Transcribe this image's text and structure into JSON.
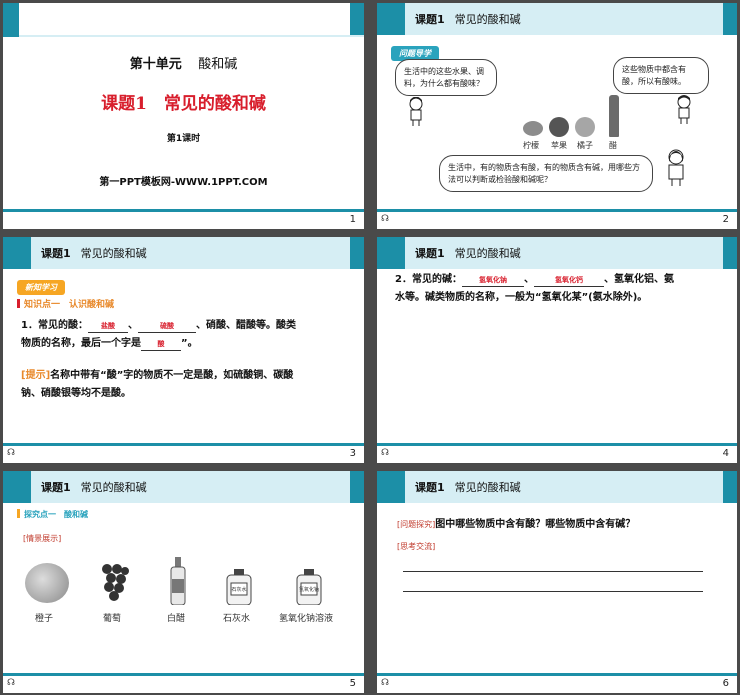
{
  "slide1": {
    "unit": "第十单元",
    "unit_name": "酸和碱",
    "lesson_title": "课题1　常见的酸和碱",
    "period": "第1课时",
    "site": "第一PPT模板网-WWW.1PPT.COM",
    "page": "1"
  },
  "header": {
    "lesson": "课题1",
    "topic": "常见的酸和碱"
  },
  "slide2": {
    "tag": "问题导学",
    "q1": "生活中的这些水果、调料，为什么都有酸味？",
    "q2": "这些物质中都含有酸，所以有酸味。",
    "q3": "生活中，有的物质含有酸，有的物质含有碱，用哪些方法可以判断或检验酸和碱呢？",
    "labels": [
      "柠檬",
      "苹果",
      "橘子",
      "醋"
    ],
    "page": "2"
  },
  "slide3": {
    "tag": "新知学习",
    "point": "知识点一　认识酸和碱",
    "l1a": "1．常见的酸：",
    "ans1": "盐酸",
    "sep1": "、",
    "ans2": "硫酸",
    "l1b": "、硝酸、醋酸等。酸类",
    "l2a": "物质的名称，最后一个字是",
    "ans3": "酸",
    "l2b": "”。",
    "hint_tag": "[提示]",
    "hint1": "名称中带有“酸”字的物质不一定是酸，如硫酸铜、碳酸",
    "hint2": "钠、硝酸银等均不是酸。",
    "page": "3"
  },
  "slide4": {
    "l1a": "2．常见的碱：",
    "ans1": "氢氧化钠",
    "sep1": "、",
    "ans2": "氢氧化钙",
    "l1b": "、氢氧化铝、氨",
    "l2": "水等。碱类物质的名称，一般为“氢氧化某”(氨水除外)。",
    "page": "4"
  },
  "slide5": {
    "point": "探究点一　酸和碱",
    "scene": "[情景展示]",
    "items": [
      "橙子",
      "葡萄",
      "白醋",
      "石灰水",
      "氢氧化钠溶液"
    ],
    "bottle_labels": [
      "石灰水",
      "氢氧化钠"
    ],
    "page": "5"
  },
  "slide6": {
    "tag": "[问题探究]",
    "question": "图中哪些物质中含有酸？哪些物质中含有碱？",
    "think": "[思考交流]",
    "page": "6"
  },
  "colors": {
    "teal": "#1c8fa7",
    "light": "#d6eef4",
    "red": "#d81e2c",
    "orange": "#f6a623"
  },
  "icons": {
    "footer": "link-icon"
  }
}
